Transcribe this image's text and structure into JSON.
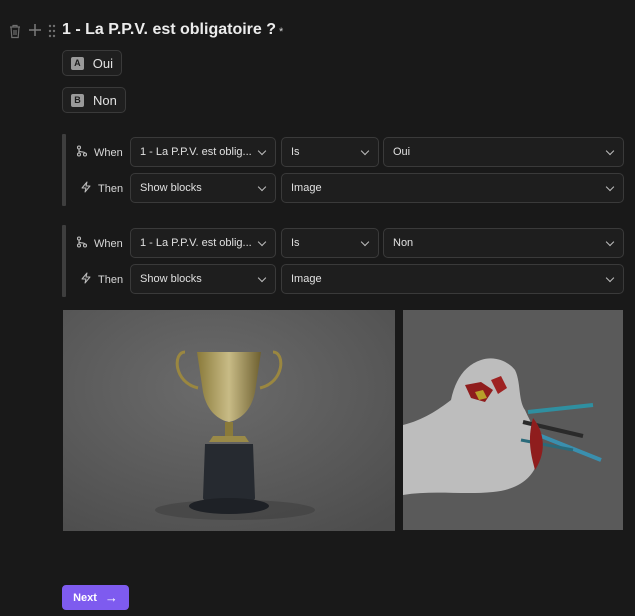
{
  "question": {
    "title": "1 - La P.P.V. est obligatoire ?",
    "required_mark": "*"
  },
  "choices": [
    {
      "letter": "A",
      "label": "Oui"
    },
    {
      "letter": "B",
      "label": "Non"
    }
  ],
  "rules": [
    {
      "when_label": "When",
      "then_label": "Then",
      "field": "1 - La P.P.V. est oblig...",
      "operator": "Is",
      "value": "Oui",
      "action": "Show blocks",
      "target": "Image"
    },
    {
      "when_label": "When",
      "then_label": "Then",
      "field": "1 - La P.P.V. est oblig...",
      "operator": "Is",
      "value": "Non",
      "action": "Show blocks",
      "target": "Image"
    }
  ],
  "next_button": {
    "label": "Next",
    "arrow": "→"
  },
  "icons": {
    "delete": "trash-icon",
    "add": "plus-icon",
    "drag": "drag-handle-icon",
    "condition": "branch-icon",
    "action": "lightning-icon",
    "more": "vertical-dots-icon"
  },
  "colors": {
    "background": "#191919",
    "accent": "#7e5bef"
  }
}
